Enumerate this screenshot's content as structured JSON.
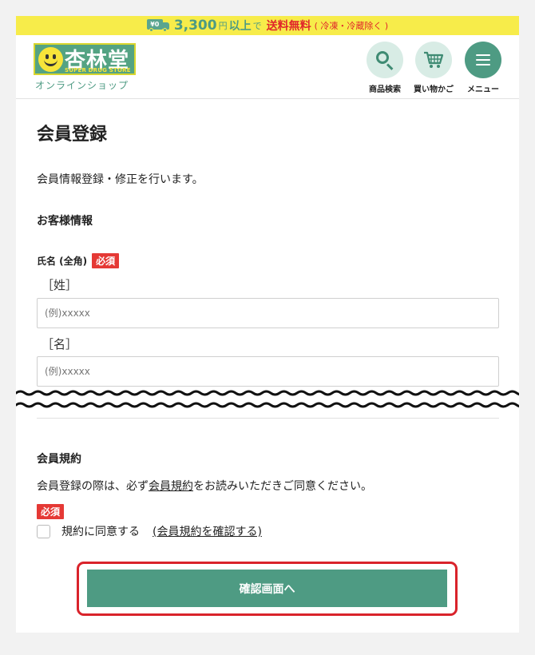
{
  "banner": {
    "icon": "truck-icon",
    "truck_label": "¥0",
    "amount": "3,300",
    "yen": "円",
    "above": "以上",
    "de": "で",
    "free_shipping": "送料無料",
    "exclusion": "( 冷凍・冷蔵除く )",
    "bg_color": "#f7ec4a"
  },
  "header": {
    "logo_text": "杏林堂",
    "logo_sub": "SUPER DRUG STORE",
    "online_shop": "オンラインショップ",
    "buttons": [
      {
        "label": "商品検索",
        "icon": "search-icon"
      },
      {
        "label": "買い物かご",
        "icon": "cart-icon"
      },
      {
        "label": "メニュー",
        "icon": "menu-icon"
      }
    ]
  },
  "page": {
    "title": "会員登録",
    "intro": "会員情報登録・修正を行います。"
  },
  "customer": {
    "heading": "お客様情報",
    "name_label": "氏名 (全角)",
    "required": "必須",
    "last_name_label": "［姓］",
    "last_name_placeholder": "(例)xxxxx",
    "first_name_label": "［名］",
    "first_name_placeholder": "(例)xxxxx"
  },
  "terms": {
    "heading": "会員規約",
    "text_before": "会員登録の際は、必ず",
    "text_link": "会員規約",
    "text_after": "をお読みいただきご同意ください。",
    "required": "必須",
    "agree_label": "規約に同意する",
    "agree_link": "(会員規約を確認する)",
    "agreed": false
  },
  "confirm": {
    "label": "確認画面へ",
    "color": "#4e9b83",
    "highlight_color": "#d9232b"
  }
}
